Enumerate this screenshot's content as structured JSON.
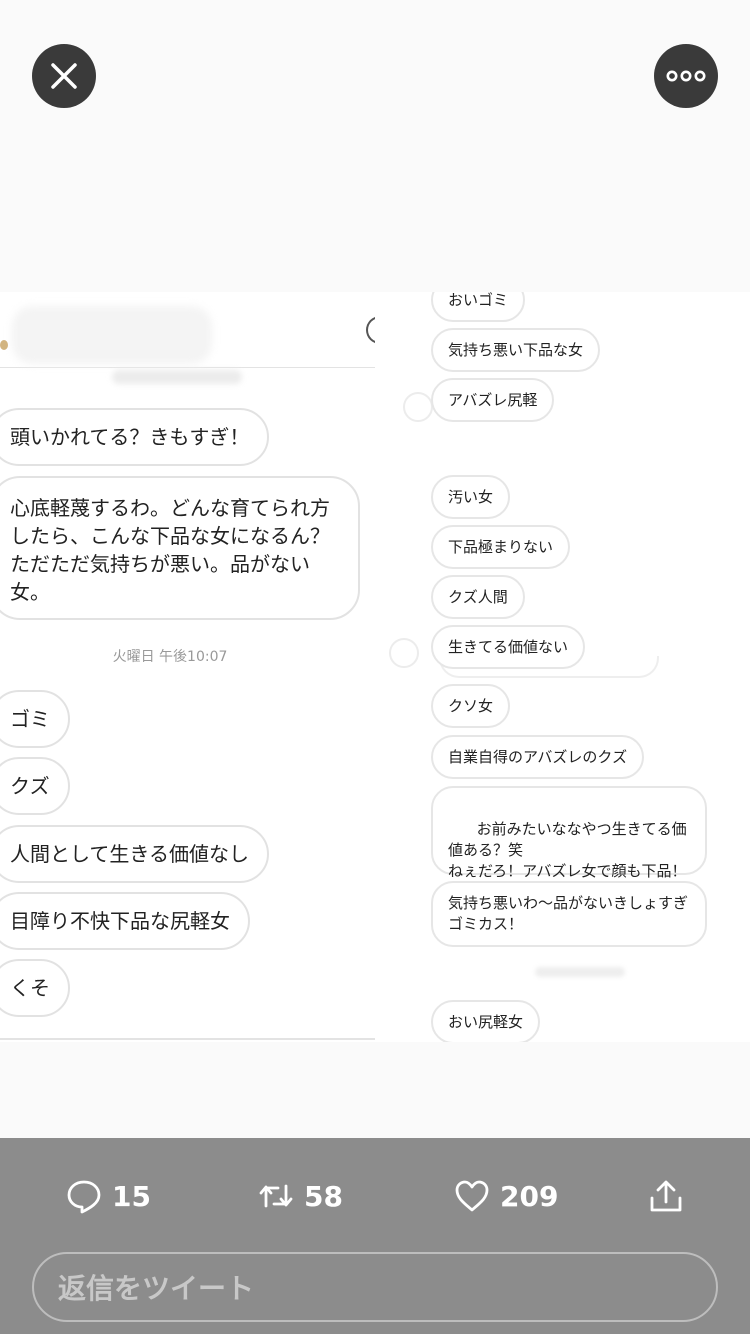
{
  "top": {
    "close_icon": "close-icon",
    "more_icon": "more-horizontal-icon"
  },
  "left_chat": {
    "messages_before": [
      "頭いかれてる？きもすぎ！",
      "心底軽蔑するわ。どんな育てられ方したら、こんな下品な女になるん？ただただ気持ちが悪い。品がない女。"
    ],
    "timestamp": "火曜日 午後10:07",
    "messages_after": [
      "ゴミ",
      "クズ",
      "人間として生きる価値なし",
      "目障り不快下品な尻軽女",
      "くそ"
    ]
  },
  "right_chat": {
    "messages": [
      "おいゴミ",
      "気持ち悪い下品な女",
      "アバズレ尻軽",
      "汚い女",
      "下品極まりない",
      "クズ人間",
      "生きてる価値ない",
      "クソ女",
      "自業自得のアバズレのクズ",
      "お前みたいななやつ生きてる価値ある？笑\nねぇだろ！アバズレ女で顔も下品！",
      "気持ち悪いわ〜品がないきしょすぎゴミカス！",
      "おい尻軽女"
    ]
  },
  "actions": {
    "reply_count": "15",
    "retweet_count": "58",
    "like_count": "209",
    "icons": [
      "reply-icon",
      "retweet-icon",
      "heart-icon",
      "share-icon"
    ]
  },
  "reply_placeholder": "返信をツイート",
  "colors": {
    "bottom_bar": "#8c8c8c",
    "top_button": "#3a3a3a",
    "bubble_border": "#e2e2e2"
  }
}
